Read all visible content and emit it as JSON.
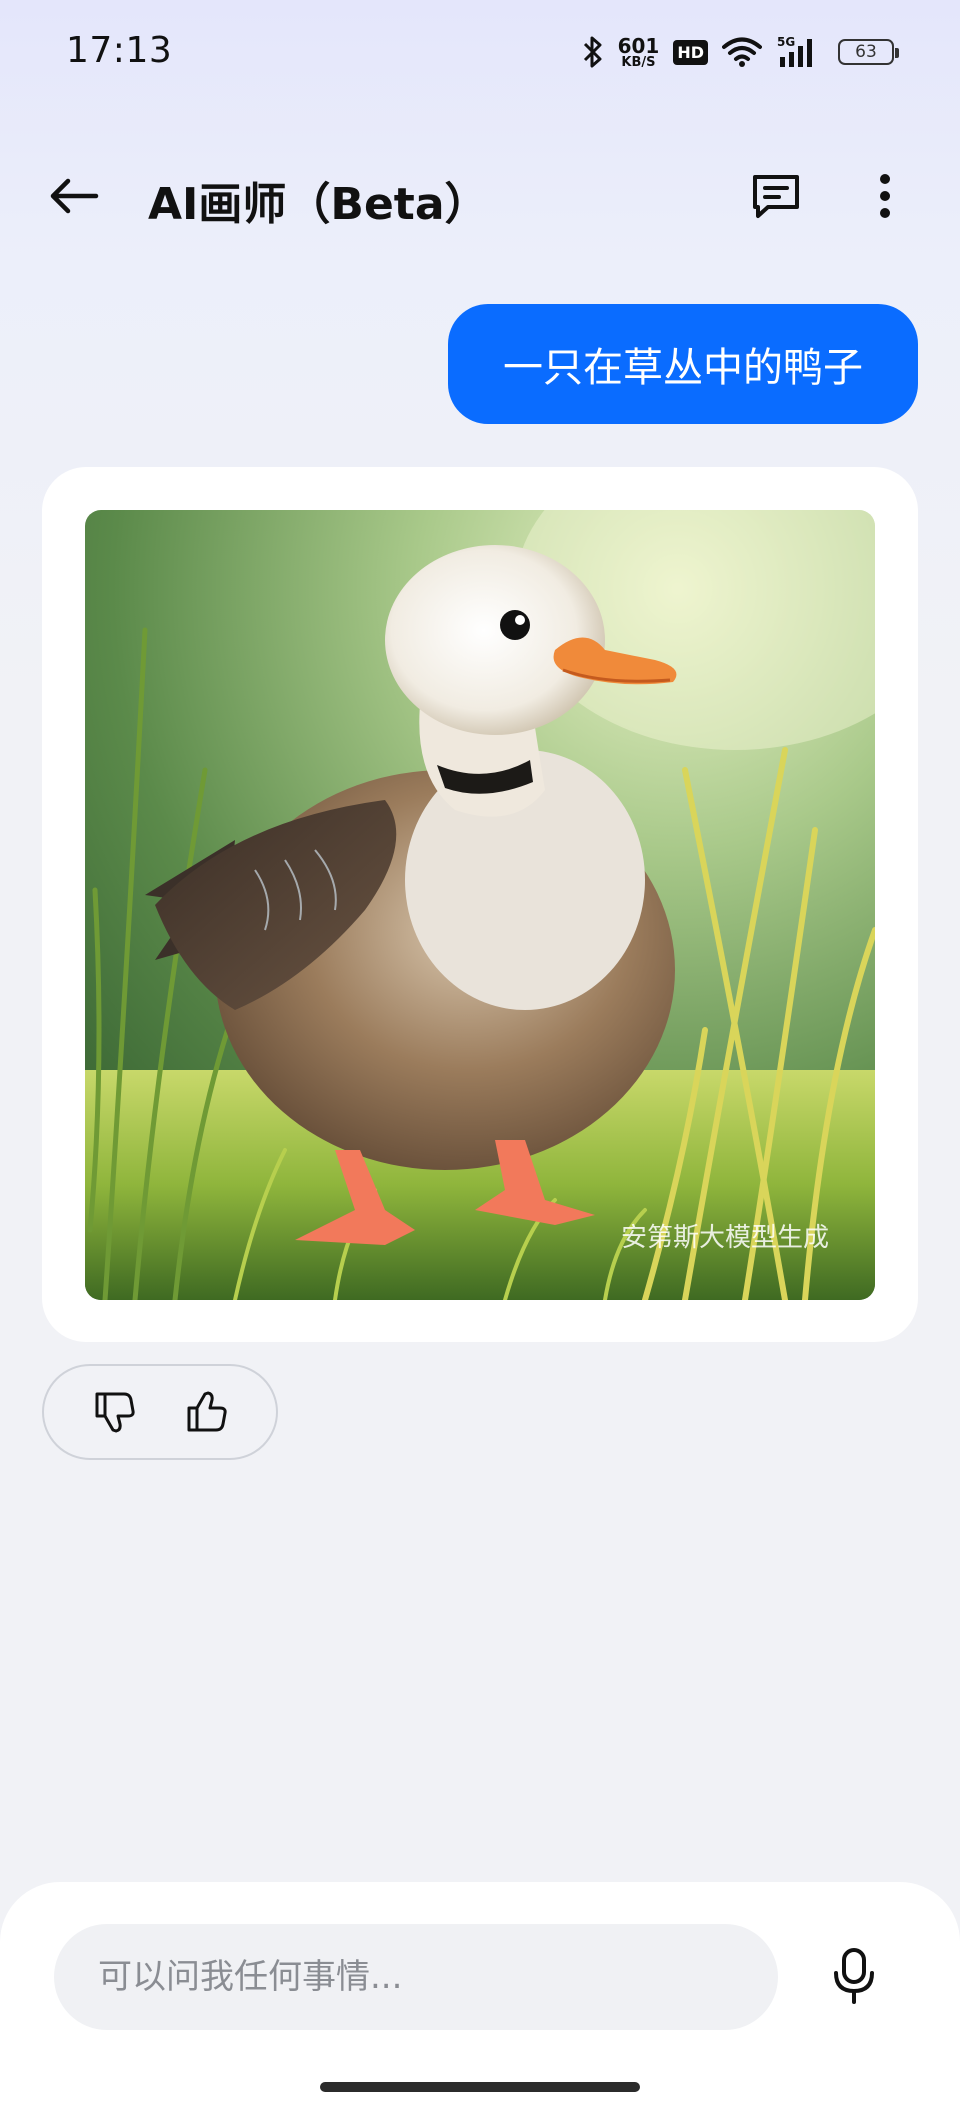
{
  "status_bar": {
    "time": "17:13",
    "net_speed_value": "601",
    "net_speed_unit": "KB/S",
    "hd_label": "HD",
    "network_label": "5G",
    "battery": "63"
  },
  "header": {
    "title": "AI画师（Beta）"
  },
  "chat": {
    "user_message": "一只在草丛中的鸭子",
    "image_watermark": "安第斯大模型生成"
  },
  "composer": {
    "placeholder": "可以问我任何事情..."
  },
  "icons": {
    "back": "back-arrow-icon",
    "chat": "chat-bubble-icon",
    "more": "more-vertical-icon",
    "dislike": "thumbs-down-icon",
    "like": "thumbs-up-icon",
    "mic": "microphone-icon"
  },
  "colors": {
    "accent": "#0a6cff",
    "card": "#ffffff",
    "background": "#f1f2f6"
  }
}
